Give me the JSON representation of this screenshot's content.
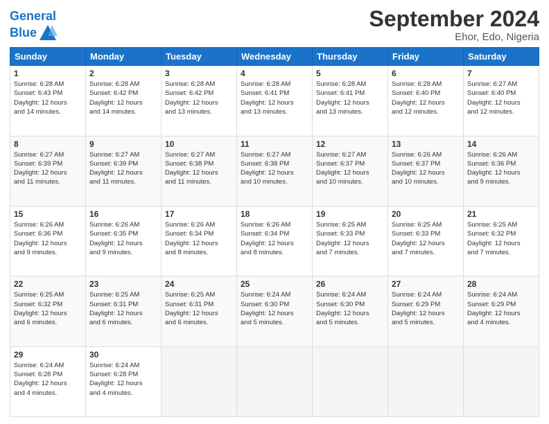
{
  "header": {
    "logo_line1": "General",
    "logo_line2": "Blue",
    "title": "September 2024",
    "subtitle": "Ehor, Edo, Nigeria"
  },
  "days": [
    "Sunday",
    "Monday",
    "Tuesday",
    "Wednesday",
    "Thursday",
    "Friday",
    "Saturday"
  ],
  "weeks": [
    [
      {
        "day": "1",
        "sunrise": "6:28 AM",
        "sunset": "6:43 PM",
        "daylight": "12 hours and 14 minutes."
      },
      {
        "day": "2",
        "sunrise": "6:28 AM",
        "sunset": "6:42 PM",
        "daylight": "12 hours and 14 minutes."
      },
      {
        "day": "3",
        "sunrise": "6:28 AM",
        "sunset": "6:42 PM",
        "daylight": "12 hours and 13 minutes."
      },
      {
        "day": "4",
        "sunrise": "6:28 AM",
        "sunset": "6:41 PM",
        "daylight": "12 hours and 13 minutes."
      },
      {
        "day": "5",
        "sunrise": "6:28 AM",
        "sunset": "6:41 PM",
        "daylight": "12 hours and 13 minutes."
      },
      {
        "day": "6",
        "sunrise": "6:28 AM",
        "sunset": "6:40 PM",
        "daylight": "12 hours and 12 minutes."
      },
      {
        "day": "7",
        "sunrise": "6:27 AM",
        "sunset": "6:40 PM",
        "daylight": "12 hours and 12 minutes."
      }
    ],
    [
      {
        "day": "8",
        "sunrise": "6:27 AM",
        "sunset": "6:39 PM",
        "daylight": "12 hours and 11 minutes."
      },
      {
        "day": "9",
        "sunrise": "6:27 AM",
        "sunset": "6:39 PM",
        "daylight": "12 hours and 11 minutes."
      },
      {
        "day": "10",
        "sunrise": "6:27 AM",
        "sunset": "6:38 PM",
        "daylight": "12 hours and 11 minutes."
      },
      {
        "day": "11",
        "sunrise": "6:27 AM",
        "sunset": "6:38 PM",
        "daylight": "12 hours and 10 minutes."
      },
      {
        "day": "12",
        "sunrise": "6:27 AM",
        "sunset": "6:37 PM",
        "daylight": "12 hours and 10 minutes."
      },
      {
        "day": "13",
        "sunrise": "6:26 AM",
        "sunset": "6:37 PM",
        "daylight": "12 hours and 10 minutes."
      },
      {
        "day": "14",
        "sunrise": "6:26 AM",
        "sunset": "6:36 PM",
        "daylight": "12 hours and 9 minutes."
      }
    ],
    [
      {
        "day": "15",
        "sunrise": "6:26 AM",
        "sunset": "6:36 PM",
        "daylight": "12 hours and 9 minutes."
      },
      {
        "day": "16",
        "sunrise": "6:26 AM",
        "sunset": "6:35 PM",
        "daylight": "12 hours and 9 minutes."
      },
      {
        "day": "17",
        "sunrise": "6:26 AM",
        "sunset": "6:34 PM",
        "daylight": "12 hours and 8 minutes."
      },
      {
        "day": "18",
        "sunrise": "6:26 AM",
        "sunset": "6:34 PM",
        "daylight": "12 hours and 8 minutes."
      },
      {
        "day": "19",
        "sunrise": "6:25 AM",
        "sunset": "6:33 PM",
        "daylight": "12 hours and 7 minutes."
      },
      {
        "day": "20",
        "sunrise": "6:25 AM",
        "sunset": "6:33 PM",
        "daylight": "12 hours and 7 minutes."
      },
      {
        "day": "21",
        "sunrise": "6:25 AM",
        "sunset": "6:32 PM",
        "daylight": "12 hours and 7 minutes."
      }
    ],
    [
      {
        "day": "22",
        "sunrise": "6:25 AM",
        "sunset": "6:32 PM",
        "daylight": "12 hours and 6 minutes."
      },
      {
        "day": "23",
        "sunrise": "6:25 AM",
        "sunset": "6:31 PM",
        "daylight": "12 hours and 6 minutes."
      },
      {
        "day": "24",
        "sunrise": "6:25 AM",
        "sunset": "6:31 PM",
        "daylight": "12 hours and 6 minutes."
      },
      {
        "day": "25",
        "sunrise": "6:24 AM",
        "sunset": "6:30 PM",
        "daylight": "12 hours and 5 minutes."
      },
      {
        "day": "26",
        "sunrise": "6:24 AM",
        "sunset": "6:30 PM",
        "daylight": "12 hours and 5 minutes."
      },
      {
        "day": "27",
        "sunrise": "6:24 AM",
        "sunset": "6:29 PM",
        "daylight": "12 hours and 5 minutes."
      },
      {
        "day": "28",
        "sunrise": "6:24 AM",
        "sunset": "6:29 PM",
        "daylight": "12 hours and 4 minutes."
      }
    ],
    [
      {
        "day": "29",
        "sunrise": "6:24 AM",
        "sunset": "6:28 PM",
        "daylight": "12 hours and 4 minutes."
      },
      {
        "day": "30",
        "sunrise": "6:24 AM",
        "sunset": "6:28 PM",
        "daylight": "12 hours and 4 minutes."
      },
      null,
      null,
      null,
      null,
      null
    ]
  ]
}
